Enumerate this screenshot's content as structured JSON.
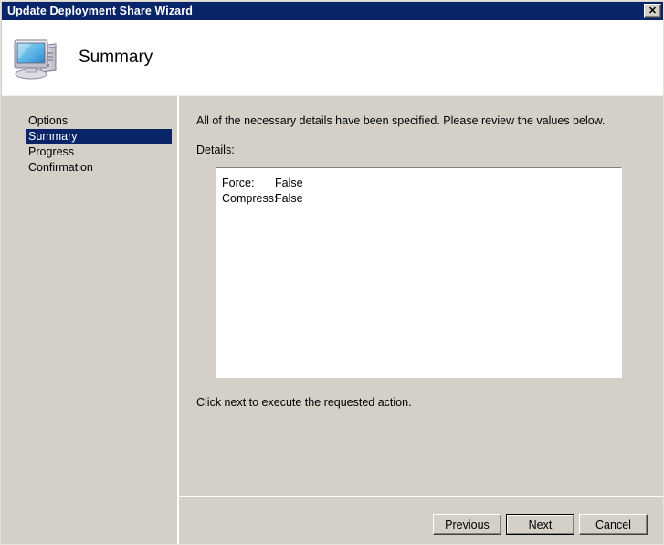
{
  "window": {
    "title": "Update Deployment Share Wizard",
    "close_label": "✕",
    "close_icon": "close-icon"
  },
  "header": {
    "title": "Summary",
    "icon": "computer-icon"
  },
  "sidebar": {
    "items": [
      {
        "label": "Options",
        "selected": false
      },
      {
        "label": "Summary",
        "selected": true
      },
      {
        "label": "Progress",
        "selected": false
      },
      {
        "label": "Confirmation",
        "selected": false
      }
    ]
  },
  "content": {
    "intro_text": "All of the necessary details have been specified.  Please review the values below.",
    "details_label": "Details:",
    "details": [
      {
        "key": "Force:",
        "value": "False"
      },
      {
        "key": "Compress:",
        "value": "False"
      }
    ],
    "footer_text": "Click next to execute the requested action."
  },
  "buttons": {
    "previous": "Previous",
    "next": "Next",
    "cancel": "Cancel"
  },
  "colors": {
    "titlebar": "#0a246a",
    "face": "#d4d0c8",
    "highlight": "#0a246a",
    "field": "#ffffff"
  }
}
